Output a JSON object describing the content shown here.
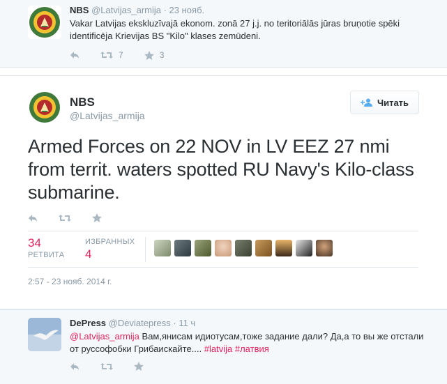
{
  "tweet_prev": {
    "name": "NBS",
    "handle": "@Latvijas_armija",
    "time": "· 23 нояб.",
    "text": "Vakar Latvijas ekskluzīvajā ekonom. zonā 27 j.j. no teritoriālās jūras bruņotie spēki identificēja Krievijas BS \"Kilo\" klases zemūdeni.",
    "retweets": "7",
    "favorites": "3"
  },
  "tweet_main": {
    "name": "NBS",
    "handle": "@Latvijas_armija",
    "follow_label": "Читать",
    "text": "Armed Forces on 22 NOV in LV EEZ 27 nmi from territ. waters spotted RU Navy's Kilo-class submarine.",
    "retweet_count": "34",
    "retweet_label": "РЕТВИТА",
    "favorite_label": "ИЗБРАННЫХ",
    "favorite_count": "4",
    "timestamp": "2:57 - 23 нояб. 2014 г."
  },
  "tweet_reply": {
    "name": "DePress",
    "handle": "@Deviatepress",
    "time": "· 11 ч",
    "mention": "@Latvijas_armija",
    "text_a": " Вам,янисам идиотусам,тоже задание дали? Да,а то вы же отстали от руссофобки Грибаискайте.... ",
    "hashtag1": "#latvija",
    "hashtag2": "#латвия"
  },
  "colors": {
    "accent": "#e0245e",
    "muted": "#8899a6",
    "text": "#292f33",
    "border": "#e1e8ed",
    "icon": "#aab8c2"
  },
  "icons": {
    "reply": "reply-icon",
    "retweet": "retweet-icon",
    "favorite": "star-icon",
    "follow": "add-user-icon"
  }
}
